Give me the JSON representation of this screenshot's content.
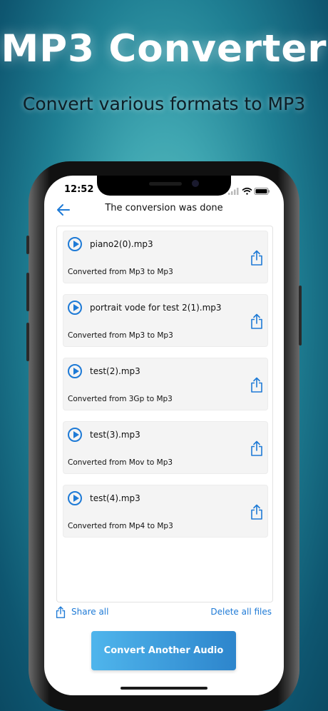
{
  "promo": {
    "title": "MP3 Converter",
    "subtitle": "Convert various formats to MP3"
  },
  "status_bar": {
    "time": "12:52"
  },
  "nav": {
    "title": "The conversion was done"
  },
  "files": [
    {
      "name": "piano2(0).mp3",
      "desc": "Converted from Mp3 to Mp3"
    },
    {
      "name": "portrait vode for test 2(1).mp3",
      "desc": "Converted from Mp3 to Mp3"
    },
    {
      "name": "test(2).mp3",
      "desc": "Converted from 3Gp to Mp3"
    },
    {
      "name": "test(3).mp3",
      "desc": "Converted from Mov to Mp3"
    },
    {
      "name": "test(4).mp3",
      "desc": "Converted from Mp4 to Mp3"
    }
  ],
  "actions": {
    "share_all": "Share all",
    "delete_all": "Delete all files",
    "convert_another": "Convert Another Audio"
  },
  "colors": {
    "accent": "#1e7ad6",
    "button_start": "#4fb5ec",
    "button_end": "#2d85cc"
  }
}
